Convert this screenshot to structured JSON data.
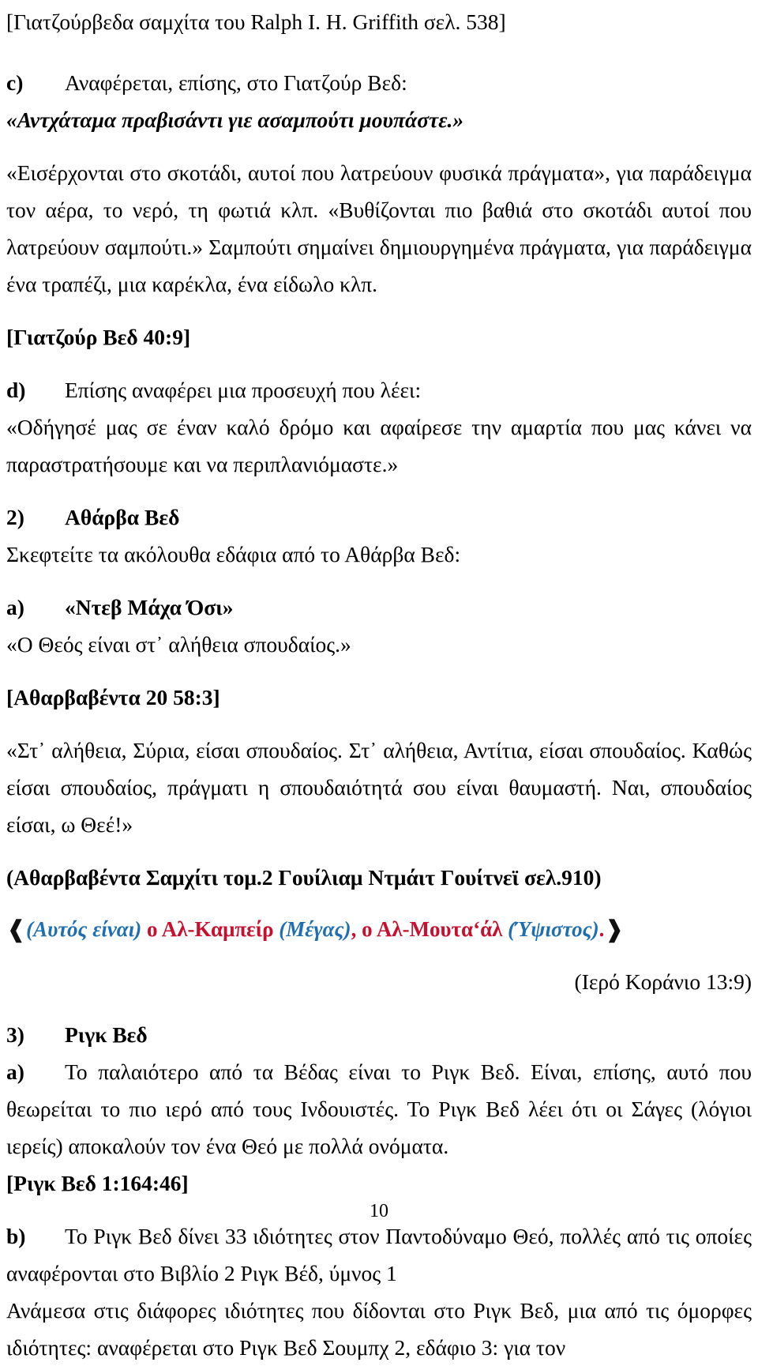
{
  "document": {
    "page_number": "10",
    "colors": {
      "text": "#000000",
      "quran_red": "#C8102E",
      "quran_blue": "#1F6FB0"
    }
  },
  "blocks": {
    "source_header": "[Γιατζούρβεδα σαμχίτα του Ralph I. H. Griffith σελ. 538]",
    "item_c": {
      "label": "c)",
      "text": "Αναφέρεται, επίσης, στο Γιατζούρ Βεδ:"
    },
    "quote_c_bold": "«Αντχάταμα πραβισάντι γιε ασαμπούτι μουπάστε.»",
    "para_c_body": "«Εισέρχονται στο σκοτάδι, αυτοί που λατρεύουν φυσικά πράγματα», για παράδειγμα τον αέρα, το νερό, τη φωτιά κλπ. «Βυθίζονται πιο βαθιά στο σκοτάδι αυτοί που λατρεύουν σαμπούτι.» Σαμπούτι σημαίνει δημιουργημένα πράγματα, για παράδειγμα ένα τραπέζι, μια καρέκλα, ένα είδωλο κλπ.",
    "ref_yajur": "[Γιατζούρ Βεδ 40:9]",
    "item_d": {
      "label": "d)",
      "text": "Επίσης αναφέρει μια προσευχή που λέει:"
    },
    "quote_d": "«Οδήγησέ μας σε έναν καλό δρόμο και αφαίρεσε την αμαρτία που μας κάνει να παραστρατήσουμε και να περιπλανιόμαστε.»",
    "item_2": {
      "label": "2)",
      "title": "Αθάρβα Βεδ"
    },
    "para_2_intro": "Σκεφτείτε τα ακόλουθα εδάφια από το Αθάρβα Βεδ:",
    "item_a": {
      "label": "a)",
      "title": "«Ντεβ Μάχα Όσι»"
    },
    "quote_a": "«Ο Θεός είναι στ᾽ αλήθεια σπουδαίος.»",
    "ref_atharva": "[Αθαρβαβέντα 20 58:3]",
    "para_atharva_body": "«Στ᾽ αλήθεια, Σύρια, είσαι σπουδαίος. Στ᾽ αλήθεια, Αντίτια, είσαι σπουδαίος. Καθώς είσαι σπουδαίος, πράγματι η σπουδαιότητά σου είναι θαυμαστή. Ναι, σπουδαίος είσαι, ω Θεέ!»",
    "ref_atharva_samhiti": "(Αθαρβαβέντα Σαμχίτι τομ.2 Γουίλιαμ Ντμάιτ Γουίτνεϊ σελ.910)",
    "quran_verse": {
      "ornament_left": "❰",
      "ornament_right": "❱",
      "segments": [
        {
          "text": "(Αυτός είναι)",
          "color": "blue"
        },
        {
          "text": " ο Αλ-Καμπείρ ",
          "color": "red"
        },
        {
          "text": "(Μέγας)",
          "color": "blue"
        },
        {
          "text": ", ο Αλ-Μουταʻάλ ",
          "color": "red"
        },
        {
          "text": "(Ύψιστος)",
          "color": "blue"
        },
        {
          "text": ".",
          "color": "red"
        }
      ]
    },
    "quran_reference": "(Ιερό Κοράνιο 13:9)",
    "item_3": {
      "label": "3)",
      "title": "Ριγκ Βεδ"
    },
    "item_3a": {
      "label": "a)",
      "text": "Το παλαιότερο από τα Βέδας είναι το Ριγκ Βεδ. Είναι, επίσης, αυτό που θεωρείται το πιο ιερό από τους Ινδουιστές. Το Ριγκ Βεδ λέει ότι οι Σάγες (λόγιοι ιερείς) αποκαλούν τον ένα Θεό με πολλά ονόματα."
    },
    "ref_rig": "[Ριγκ Βεδ 1:164:46]",
    "item_3b": {
      "label": "b)",
      "text": "Το Ριγκ Βεδ δίνει 33 ιδιότητες στον Παντοδύναμο Θεό, πολλές από τις οποίες αναφέρονται στο Βιβλίο 2 Ριγκ Βέδ, ύμνος 1"
    },
    "para_3b_cont": "Ανάμεσα στις διάφορες ιδιότητες που δίδονται στο Ριγκ Βεδ, μια από τις όμορφες ιδιότητες: αναφέρεται στο Ριγκ Βεδ Σουμπχ 2, εδάφιο 3: για τον"
  }
}
